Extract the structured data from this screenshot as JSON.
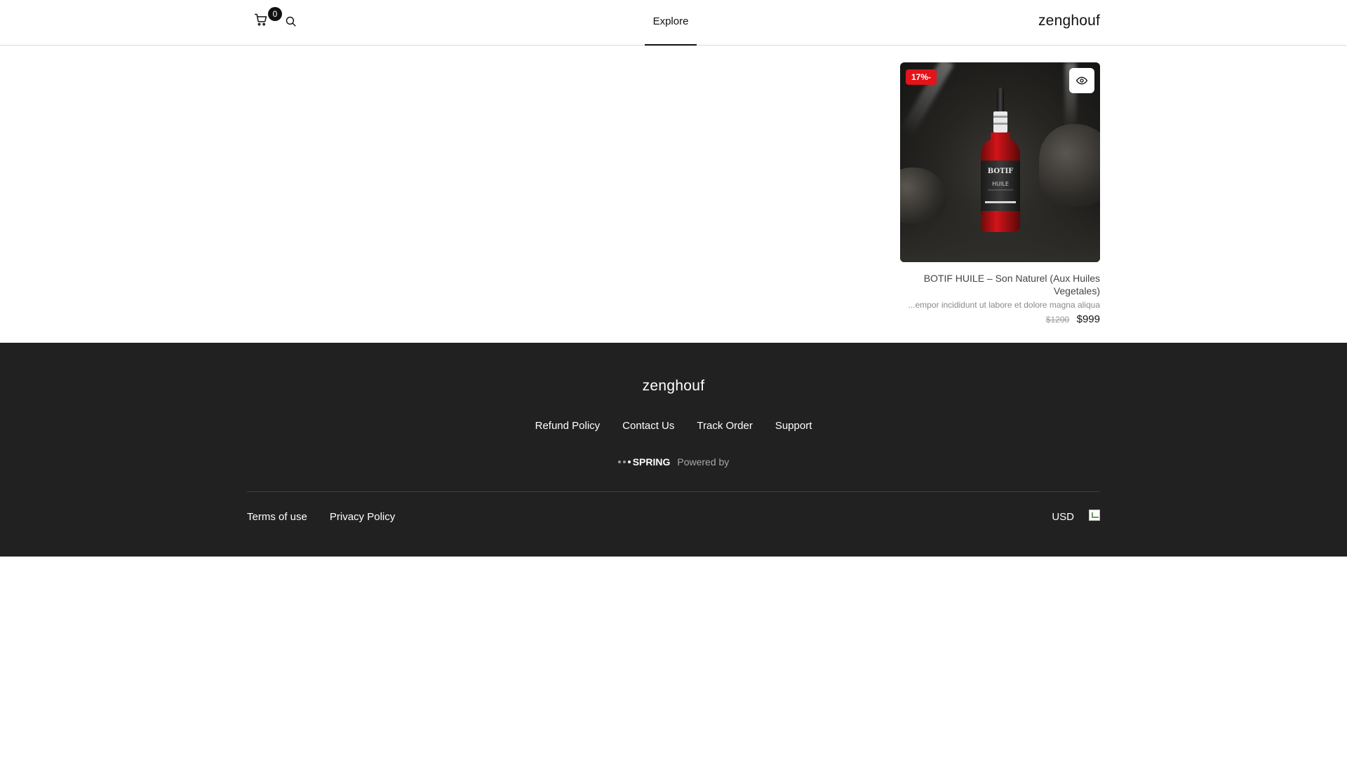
{
  "header": {
    "cart_count": "0",
    "nav_explore": "Explore",
    "brand": "zenghouf"
  },
  "product": {
    "discount": "17%-",
    "title": "BOTIF HUILE – Son Naturel (Aux Huiles Vegetales)",
    "description": "...empor incididunt ut labore et dolore magna aliqua",
    "old_price": "$1200",
    "price": "$999",
    "image_label_brand": "BOTIF",
    "image_label_sub": "HUILE"
  },
  "footer": {
    "brand": "zenghouf",
    "links": [
      "Refund Policy",
      "Contact Us",
      "Track Order",
      "Support"
    ],
    "powered_logo": "SPRING",
    "powered_text": "Powered by",
    "legal": [
      "Terms of use",
      "Privacy Policy"
    ],
    "currency": "USD"
  },
  "colors": {
    "footer_bg": "#212121",
    "badge_red": "#e3131a",
    "text_dark": "#111111"
  }
}
